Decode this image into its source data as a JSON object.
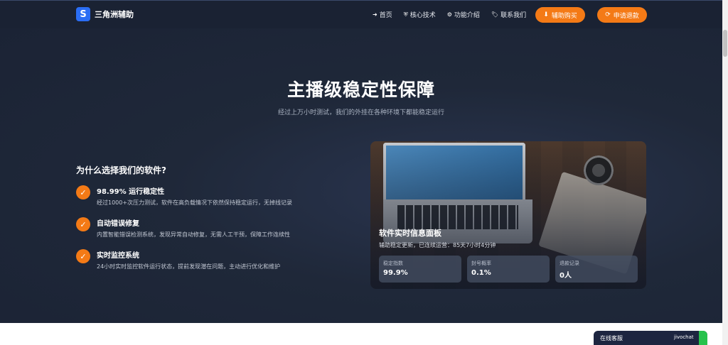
{
  "navbar": {
    "brand_logo": "S",
    "brand_name": "三角洲辅助",
    "links": [
      {
        "icon": "arrow-right-icon",
        "label": "首页"
      },
      {
        "icon": "shield-icon",
        "label": "核心技术"
      },
      {
        "icon": "cogs-icon",
        "label": "功能介绍"
      },
      {
        "icon": "tags-icon",
        "label": "联系我们"
      }
    ],
    "buy_label": "辅助购买",
    "apply_label": "申请退款"
  },
  "hero": {
    "title": "主播级稳定性保障",
    "subtitle": "经过上万小时测试，我们的外挂在各种环境下都能稳定运行"
  },
  "why": {
    "title": "为什么选择我们的软件?",
    "features": [
      {
        "title": "98.99% 运行稳定性",
        "desc": "经过1000+次压力测试，软件在高负载情况下依然保持稳定运行，无掉线记录"
      },
      {
        "title": "自动错误修复",
        "desc": "内置智能错误检测系统，发现异常自动修复，无需人工干预，保障工作连续性"
      },
      {
        "title": "实时监控系统",
        "desc": "24小时实时监控软件运行状态，提前发现潜在问题，主动进行优化和维护"
      }
    ]
  },
  "panel": {
    "title": "软件实时信息面板",
    "subtitle": "辅助稳定更新，已连续运营：85天7小时4分钟",
    "stats": [
      {
        "label": "稳定指数",
        "value": "99.9%"
      },
      {
        "label": "封号概率",
        "value": "0.1%"
      },
      {
        "label": "退款记录",
        "value": "0人"
      }
    ]
  },
  "chat": {
    "label": "在线客服",
    "brand": "jivochat"
  },
  "colors": {
    "accent": "#f47a16",
    "brand_blue": "#2a6df4",
    "hero_bg": "#1f2839"
  }
}
